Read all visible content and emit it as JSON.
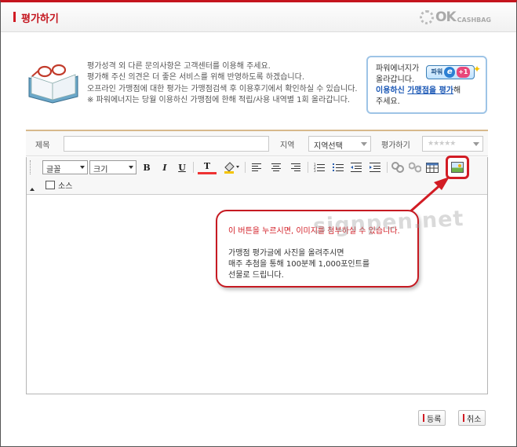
{
  "header": {
    "title": "평가하기"
  },
  "logo": {
    "ok": "OK",
    "cashbag": "CASHBAG"
  },
  "info_lines": [
    "평가성격 외 다른 문의사항은 고객센터를 이용해 주세요.",
    "평가해 주신 의견은 더 좋은 서비스를 위해 반영하도록 하겠습니다.",
    "오프라인 가맹점에 대한 평가는 가맹점검색 후 이용후기에서 확인하실 수 있습니다.",
    "※ 파워에너지는 당월 이용하신 가맹점에 한해 적립/사용 내역별 1회 올라갑니다."
  ],
  "power_box": {
    "line1": "파워에너지가",
    "line2": "올라갑니다.",
    "badge_label": "파워",
    "badge_e": "e",
    "badge_plus": "+1",
    "link_prefix": "이용하신 ",
    "link_text": "가맹점을 평가",
    "link_suffix": "해",
    "line4": "주세요."
  },
  "form": {
    "title_label": "제목",
    "title_value": "",
    "region_label": "지역",
    "region_value": "지역선택",
    "rating_label": "평가하기",
    "rating_value": "★★★★★"
  },
  "toolbar": {
    "font_label": "글꼴",
    "size_label": "크기",
    "bold": "B",
    "italic": "I",
    "underline": "U",
    "text_color": "T",
    "source_label": "소스"
  },
  "callout": {
    "line1": "이 버튼을 누르시면, 이미지를 첨부하실 수 있습니다.",
    "line2": "가맹점 평가글에 사진을 올려주시면",
    "line3": "매주 추첨을 통해 100분께 1,000포인트를",
    "line4": "선물로 드립니다."
  },
  "watermark": "signpen.net",
  "buttons": {
    "submit": "등록",
    "cancel": "취소"
  },
  "colors": {
    "brand_red": "#c4141d",
    "link_blue": "#1a57b5",
    "callout_border": "#c61a22"
  }
}
